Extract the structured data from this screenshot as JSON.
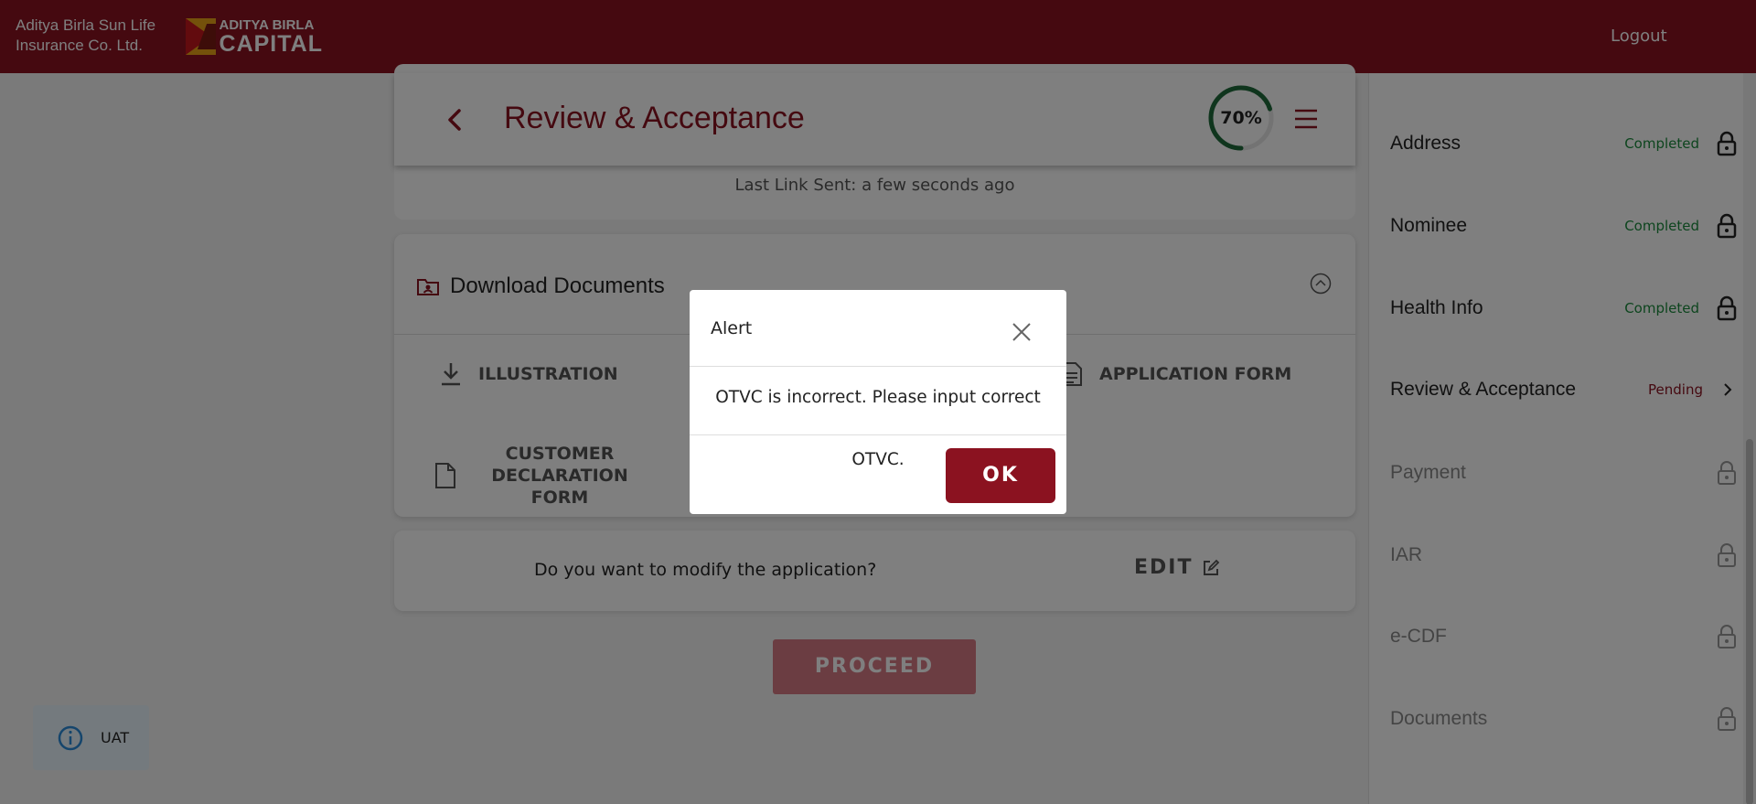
{
  "header": {
    "brand_line1": "Aditya Birla Sun Life",
    "brand_line2": "Insurance Co. Ltd.",
    "logo_top": "ADITYA BIRLA",
    "logo_bottom": "CAPITAL",
    "logout_label": "Logout"
  },
  "review": {
    "title": "Review & Acceptance",
    "progress_label": "70%",
    "progress_value": 0.7,
    "last_link": "Last Link Sent: a few seconds ago"
  },
  "documents": {
    "title": "Download Documents",
    "illustration": "ILLUSTRATION",
    "application_form": "APPLICATION FORM",
    "customer_declaration_line1": "CUSTOMER",
    "customer_declaration_line2": "DECLARATION FORM"
  },
  "modify": {
    "question": "Do you want to modify the application?",
    "edit_label": "EDIT"
  },
  "proceed_label": "PROCEED",
  "uat_label": "UAT",
  "sidebar": {
    "items": [
      {
        "name": "Address",
        "status": "Completed"
      },
      {
        "name": "Nominee",
        "status": "Completed"
      },
      {
        "name": "Health Info",
        "status": "Completed"
      },
      {
        "name": "Review & Acceptance",
        "status": "Pending"
      },
      {
        "name": "Payment",
        "status": ""
      },
      {
        "name": "IAR",
        "status": ""
      },
      {
        "name": "e-CDF",
        "status": ""
      },
      {
        "name": "Documents",
        "status": ""
      }
    ]
  },
  "dialog": {
    "title": "Alert",
    "message": "OTVC is incorrect. Please input correct OTVC.",
    "ok_label": "OK"
  },
  "colors": {
    "brand": "#8b1220",
    "completed": "#1a8a3c",
    "progress_ring": "#1f6b3a"
  }
}
